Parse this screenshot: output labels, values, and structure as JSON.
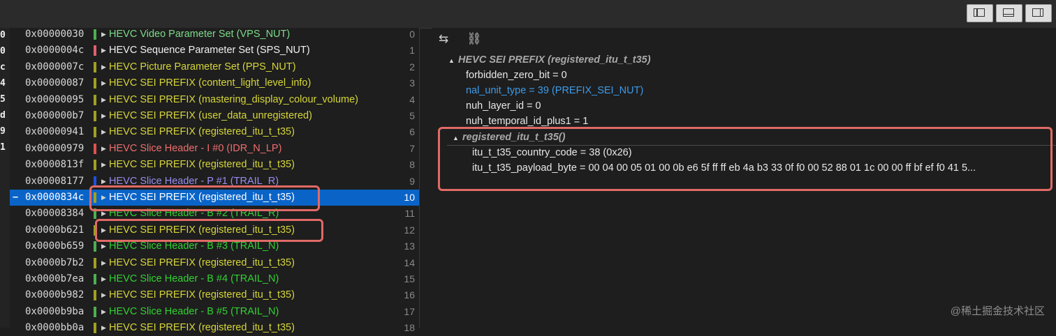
{
  "toolbar": {
    "layout_buttons": [
      {
        "icon": "left-panel-icon"
      },
      {
        "icon": "bottom-panel-icon"
      },
      {
        "icon": "right-panel-icon"
      }
    ]
  },
  "gutter_chars": [
    "0",
    "0",
    "c",
    "4",
    "5",
    "d",
    "9",
    "1"
  ],
  "nal_list": [
    {
      "addr": "0x00000030",
      "label": "HEVC Video Parameter Set (VPS_NUT)",
      "index": "0",
      "color": "#7ddc8a",
      "bar": "#4caf50"
    },
    {
      "addr": "0x0000004c",
      "label": "HEVC Sequence Parameter Set (SPS_NUT)",
      "index": "1",
      "color": "#f2f2f2",
      "bar": "#e0606a"
    },
    {
      "addr": "0x0000007c",
      "label": "HEVC Picture Parameter Set (PPS_NUT)",
      "index": "2",
      "color": "#d6d63a",
      "bar": "#a0a020"
    },
    {
      "addr": "0x00000087",
      "label": "HEVC SEI PREFIX (content_light_level_info)",
      "index": "3",
      "color": "#d6d63a",
      "bar": "#a0a020"
    },
    {
      "addr": "0x00000095",
      "label": "HEVC SEI PREFIX (mastering_display_colour_volume)",
      "index": "4",
      "color": "#d6d63a",
      "bar": "#a0a020"
    },
    {
      "addr": "0x000000b7",
      "label": "HEVC SEI PREFIX (user_data_unregistered)",
      "index": "5",
      "color": "#d6d63a",
      "bar": "#a0a020"
    },
    {
      "addr": "0x00000941",
      "label": "HEVC SEI PREFIX (registered_itu_t_t35)",
      "index": "6",
      "color": "#d6d63a",
      "bar": "#a0a020"
    },
    {
      "addr": "0x00000979",
      "label": "HEVC Slice Header - I #0 (IDR_N_LP)",
      "index": "7",
      "color": "#f06d6d",
      "bar": "#e05050"
    },
    {
      "addr": "0x0000813f",
      "label": "HEVC SEI PREFIX (registered_itu_t_t35)",
      "index": "8",
      "color": "#d6d63a",
      "bar": "#a0a020"
    },
    {
      "addr": "0x00008177",
      "label": "HEVC Slice Header - P #1 (TRAIL_R)",
      "index": "9",
      "color": "#9a8cf0",
      "bar": "#2050e0"
    },
    {
      "addr": "0x0000834c",
      "label": "HEVC SEI PREFIX (registered_itu_t_t35)",
      "index": "10",
      "color": "#ffffff",
      "bar": "#a0a020",
      "selected": true,
      "marker": "–"
    },
    {
      "addr": "0x00008384",
      "label": "HEVC Slice Header - B #2 (TRAIL_R)",
      "index": "11",
      "color": "#32d232",
      "bar": "#4caf50"
    },
    {
      "addr": "0x0000b621",
      "label": "HEVC SEI PREFIX (registered_itu_t_t35)",
      "index": "12",
      "color": "#d6d63a",
      "bar": "#a0a020"
    },
    {
      "addr": "0x0000b659",
      "label": "HEVC Slice Header - B #3 (TRAIL_N)",
      "index": "13",
      "color": "#32d232",
      "bar": "#4caf50"
    },
    {
      "addr": "0x0000b7b2",
      "label": "HEVC SEI PREFIX (registered_itu_t_t35)",
      "index": "14",
      "color": "#d6d63a",
      "bar": "#a0a020"
    },
    {
      "addr": "0x0000b7ea",
      "label": "HEVC Slice Header - B #4 (TRAIL_N)",
      "index": "15",
      "color": "#32d232",
      "bar": "#4caf50"
    },
    {
      "addr": "0x0000b982",
      "label": "HEVC SEI PREFIX (registered_itu_t_t35)",
      "index": "16",
      "color": "#d6d63a",
      "bar": "#a0a020"
    },
    {
      "addr": "0x0000b9ba",
      "label": "HEVC Slice Header - B #5 (TRAIL_N)",
      "index": "17",
      "color": "#32d232",
      "bar": "#4caf50"
    },
    {
      "addr": "0x0000bb0a",
      "label": "HEVC SEI PREFIX (registered_itu_t_t35)",
      "index": "18",
      "color": "#d6d63a",
      "bar": "#a0a020"
    }
  ],
  "detail": {
    "tools": [
      {
        "icon": "swap-arrows-icon",
        "glyph": "⇆"
      },
      {
        "icon": "tree-structure-icon",
        "glyph": "⛓"
      }
    ],
    "header": "HEVC SEI PREFIX (registered_itu_t_t35)",
    "fields": [
      {
        "text": "forbidden_zero_bit  =  0"
      },
      {
        "text": "nal_unit_type  =  39 (PREFIX_SEI_NUT)",
        "blue": true
      },
      {
        "text": "nuh_layer_id  =  0"
      },
      {
        "text": "nuh_temporal_id_plus1  =  1"
      }
    ],
    "sub_header": "registered_itu_t_t35()",
    "sub_fields": [
      {
        "text": "itu_t_t35_country_code  =  38 (0x26)"
      },
      {
        "text": "itu_t_t35_payload_byte  =  00 04 00 05 01 00 0b e6 5f ff ff eb 4a b3 33 0f f0 00 52 88 01 1c 00 00 ff bf ef f0 41 5..."
      }
    ]
  },
  "watermark": "@稀土掘金技术社区",
  "colors": {
    "highlight": "#e06a66",
    "selection": "#0a64c8",
    "field_blue": "#3d9be9"
  }
}
